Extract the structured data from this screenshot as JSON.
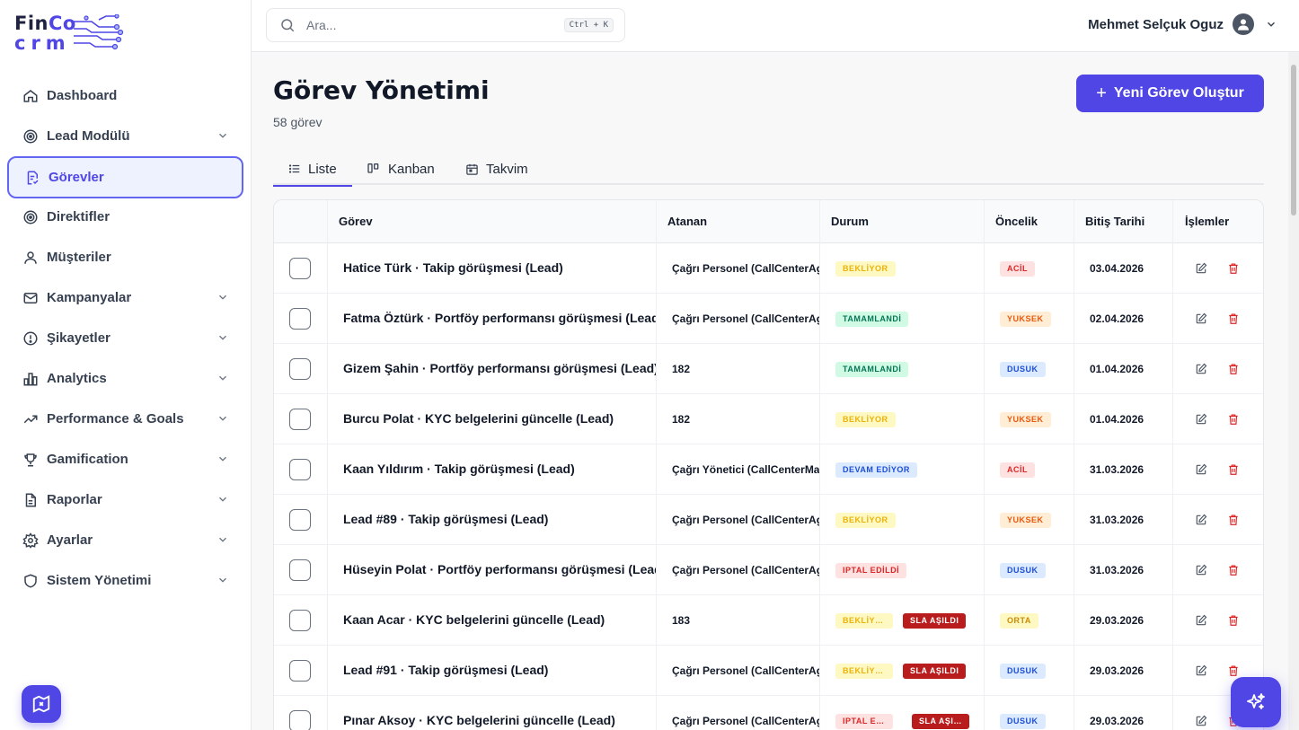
{
  "brand": {
    "line1_a": "Fin",
    "line1_b": "Co",
    "line2": "crm"
  },
  "sidebar": {
    "items": [
      {
        "label": "Dashboard",
        "icon": "home-icon",
        "expandable": false
      },
      {
        "label": "Lead Modülü",
        "icon": "target-icon",
        "expandable": true
      },
      {
        "label": "Görevler",
        "icon": "task-file-icon",
        "expandable": false,
        "active": true
      },
      {
        "label": "Direktifler",
        "icon": "target-icon",
        "expandable": false
      },
      {
        "label": "Müşteriler",
        "icon": "user-icon",
        "expandable": false
      },
      {
        "label": "Kampanyalar",
        "icon": "mail-icon",
        "expandable": true
      },
      {
        "label": "Şikayetler",
        "icon": "alert-circle-icon",
        "expandable": true
      },
      {
        "label": "Analytics",
        "icon": "bar-chart-icon",
        "expandable": true
      },
      {
        "label": "Performance & Goals",
        "icon": "trend-up-icon",
        "expandable": true
      },
      {
        "label": "Gamification",
        "icon": "trophy-icon",
        "expandable": true
      },
      {
        "label": "Raporlar",
        "icon": "report-icon",
        "expandable": true
      },
      {
        "label": "Ayarlar",
        "icon": "gear-icon",
        "expandable": true
      },
      {
        "label": "Sistem Yönetimi",
        "icon": "shield-icon",
        "expandable": true
      }
    ]
  },
  "header": {
    "search_placeholder": "Ara...",
    "search_shortcut": "Ctrl + K",
    "user_name": "Mehmet Selçuk Oguz"
  },
  "page": {
    "title": "Görev Yönetimi",
    "count": "58 görev",
    "new_button": "Yeni Görev Oluştur"
  },
  "tabs": [
    {
      "label": "Liste",
      "icon": "list-icon",
      "active": true
    },
    {
      "label": "Kanban",
      "icon": "kanban-icon",
      "active": false
    },
    {
      "label": "Takvim",
      "icon": "calendar-icon",
      "active": false
    }
  ],
  "table": {
    "headers": {
      "task": "Görev",
      "assignee": "Atanan",
      "status": "Durum",
      "priority": "Öncelik",
      "due": "Bitiş Tarihi",
      "actions": "İşlemler"
    },
    "rows": [
      {
        "task": "Hatice Türk · Takip görüşmesi (Lead)",
        "assignee": "Çağrı Personel (CallCenterAgent)",
        "status": "BEKLİYOR",
        "status_type": "bekliyor",
        "sla": "",
        "priority": "ACİL",
        "priority_type": "acil",
        "due": "03.04.2026"
      },
      {
        "task": "Fatma Öztürk · Portföy performansı görüşmesi (Lead)",
        "assignee": "Çağrı Personel (CallCenterAgent)",
        "status": "TAMAMLANDİ",
        "status_type": "tamam",
        "sla": "",
        "priority": "YUKSEK",
        "priority_type": "yuksek",
        "due": "02.04.2026"
      },
      {
        "task": "Gizem Şahin · Portföy performansı görüşmesi (Lead)",
        "assignee": "182",
        "status": "TAMAMLANDİ",
        "status_type": "tamam",
        "sla": "",
        "priority": "DUSUK",
        "priority_type": "dusuk",
        "due": "01.04.2026"
      },
      {
        "task": "Burcu Polat · KYC belgelerini güncelle (Lead)",
        "assignee": "182",
        "status": "BEKLİYOR",
        "status_type": "bekliyor",
        "sla": "",
        "priority": "YUKSEK",
        "priority_type": "yuksek",
        "due": "01.04.2026"
      },
      {
        "task": "Kaan Yıldırım · Takip görüşmesi (Lead)",
        "assignee": "Çağrı Yönetici (CallCenterManager)",
        "status": "DEVAM EDİYOR",
        "status_type": "devam",
        "sla": "",
        "priority": "ACİL",
        "priority_type": "acil",
        "due": "31.03.2026"
      },
      {
        "task": "Lead #89 · Takip görüşmesi (Lead)",
        "assignee": "Çağrı Personel (CallCenterAgent)",
        "status": "BEKLİYOR",
        "status_type": "bekliyor",
        "sla": "",
        "priority": "YUKSEK",
        "priority_type": "yuksek",
        "due": "31.03.2026"
      },
      {
        "task": "Hüseyin Polat · Portföy performansı görüşmesi (Lead)",
        "assignee": "Çağrı Personel (CallCenterAgent)",
        "status": "IPTAL EDİLDİ",
        "status_type": "iptal",
        "sla": "",
        "priority": "DUSUK",
        "priority_type": "dusuk",
        "due": "31.03.2026"
      },
      {
        "task": "Kaan Acar · KYC belgelerini güncelle (Lead)",
        "assignee": "183",
        "status": "BEKLİYOR",
        "status_type": "bekliyor",
        "sla": "SLA AŞILDI",
        "priority": "ORTA",
        "priority_type": "orta",
        "due": "29.03.2026"
      },
      {
        "task": "Lead #91 · Takip görüşmesi (Lead)",
        "assignee": "Çağrı Personel (CallCenterAgent)",
        "status": "BEKLİYOR",
        "status_type": "bekliyor",
        "sla": "SLA AŞILDI",
        "priority": "DUSUK",
        "priority_type": "dusuk",
        "due": "29.03.2026"
      },
      {
        "task": "Pınar Aksoy · KYC belgelerini güncelle (Lead)",
        "assignee": "Çağrı Personel (CallCenterAgent)",
        "status": "IPTAL EDİLDİ",
        "status_type": "iptal",
        "sla": "SLA AŞILDI",
        "priority": "DUSUK",
        "priority_type": "dusuk",
        "due": "29.03.2026"
      }
    ]
  },
  "colors": {
    "accent": "#4f46e5",
    "sidebar_active_bg": "#eef2ff",
    "danger": "#b91c1c"
  }
}
